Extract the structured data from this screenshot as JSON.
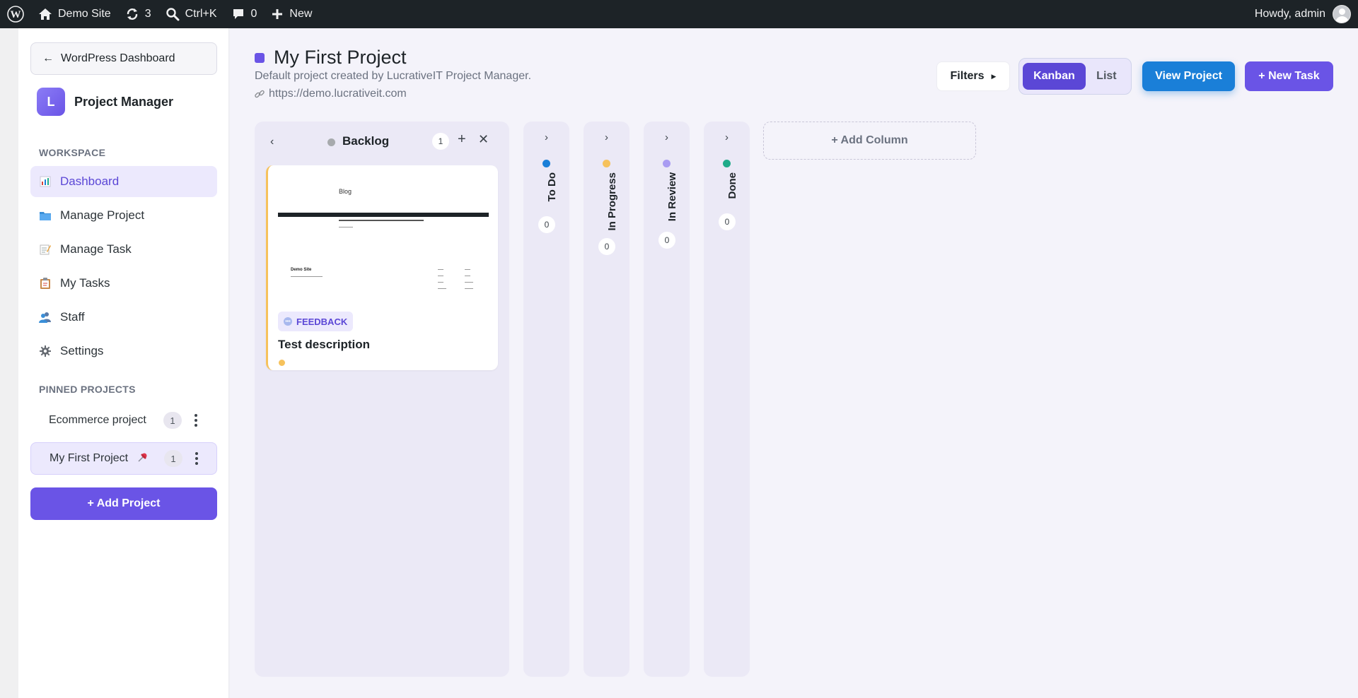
{
  "adminbar": {
    "site_name": "Demo Site",
    "updates_count": "3",
    "search_shortcut": "Ctrl+K",
    "comments_count": "0",
    "new_label": "New",
    "howdy": "Howdy, admin"
  },
  "sidebar": {
    "back_label": "WordPress Dashboard",
    "brand_logo": "L",
    "brand_name": "Project Manager",
    "workspace_label": "WORKSPACE",
    "nav": [
      {
        "label": "Dashboard",
        "icon": "bar-chart-icon",
        "active": true
      },
      {
        "label": "Manage Project",
        "icon": "folder-icon",
        "active": false
      },
      {
        "label": "Manage Task",
        "icon": "memo-icon",
        "active": false
      },
      {
        "label": "My Tasks",
        "icon": "clipboard-icon",
        "active": false
      },
      {
        "label": "Staff",
        "icon": "people-icon",
        "active": false
      },
      {
        "label": "Settings",
        "icon": "gear-icon",
        "active": false
      }
    ],
    "pinned_label": "PINNED PROJECTS",
    "pinned": [
      {
        "name": "Ecommerce project",
        "count": "1",
        "pinned_icon": false
      },
      {
        "name": "My First Project",
        "count": "1",
        "pinned_icon": true
      }
    ],
    "add_project_label": "+ Add Project"
  },
  "project": {
    "title": "My First Project",
    "description": "Default project created by LucrativeIT Project Manager.",
    "url": "https://demo.lucrativeit.com",
    "color": "#6a54e6"
  },
  "toolbar": {
    "filters_label": "Filters",
    "kanban_label": "Kanban",
    "list_label": "List",
    "view_project_label": "View Project",
    "new_task_label": "+ New Task"
  },
  "board": {
    "backlog": {
      "name": "Backlog",
      "count": "1",
      "color": "#a7aaad",
      "card": {
        "thumb_title": "Blog",
        "thumb_site": "Demo Site",
        "badge": "FEEDBACK",
        "title": "Test description",
        "priority_color": "#f6c25c"
      }
    },
    "collapsed_columns": [
      {
        "name": "To Do",
        "count": "0",
        "color": "#1a7fd8"
      },
      {
        "name": "In Progress",
        "count": "0",
        "color": "#f6c25c"
      },
      {
        "name": "In Review",
        "count": "0",
        "color": "#a99cf2"
      },
      {
        "name": "Done",
        "count": "0",
        "color": "#1fab89"
      }
    ],
    "add_column_label": "+ Add Column"
  }
}
